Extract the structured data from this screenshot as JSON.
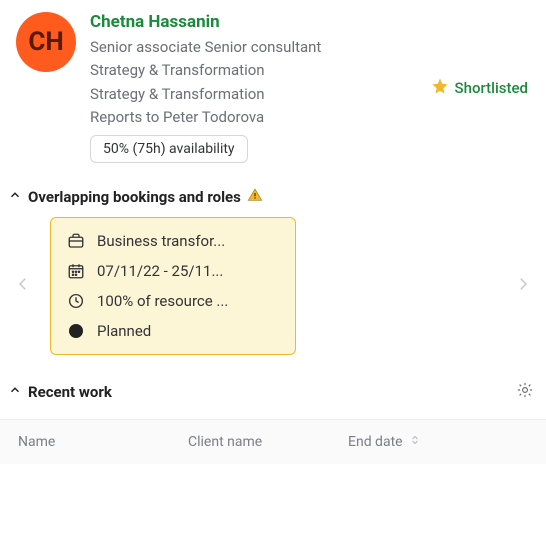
{
  "profile": {
    "avatar_initials": "CH",
    "name": "Chetna Hassanin",
    "role_line": "Senior associate  Senior consultant",
    "dept_line1": "Strategy & Transformation",
    "dept_line2": "Strategy & Transformation",
    "reports_to_line": "Reports to Peter Todorova",
    "availability": "50% (75h) availability",
    "shortlisted_label": "Shortlisted"
  },
  "sections": {
    "overlap_title": "Overlapping bookings and roles",
    "recent_work_title": "Recent work"
  },
  "booking_card": {
    "project": "Business transfor...",
    "dates": "07/11/22 - 25/11...",
    "allocation": "100% of resource ...",
    "status": "Planned"
  },
  "recent_work_table": {
    "col_name": "Name",
    "col_client": "Client name",
    "col_end": "End date"
  }
}
